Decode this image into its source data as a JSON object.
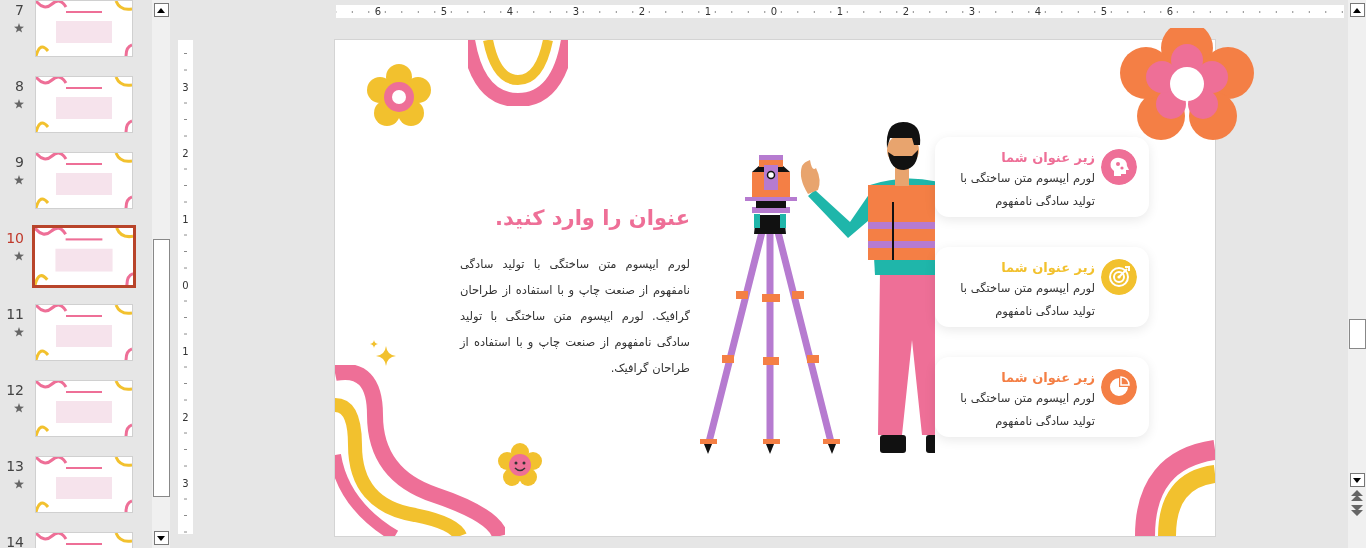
{
  "slide_panel": {
    "slides": [
      {
        "number": "7",
        "selected": false
      },
      {
        "number": "8",
        "selected": false
      },
      {
        "number": "9",
        "selected": false
      },
      {
        "number": "10",
        "selected": true
      },
      {
        "number": "11",
        "selected": false
      },
      {
        "number": "12",
        "selected": false
      },
      {
        "number": "13",
        "selected": false
      },
      {
        "number": "14",
        "selected": false
      }
    ]
  },
  "rulers": {
    "horizontal": [
      "6",
      "5",
      "4",
      "3",
      "2",
      "1",
      "0",
      "1",
      "2",
      "3",
      "4",
      "5",
      "6"
    ],
    "vertical": [
      "3",
      "2",
      "1",
      "0",
      "1",
      "2",
      "3"
    ]
  },
  "slide": {
    "title": "عنوان را وارد کنید.",
    "body": "لورم ایپسوم متن ساختگی با تولید سادگی نامفهوم از صنعت چاپ و با استفاده از طراحان گرافیک. لورم ایپسوم متن ساختگی با تولید سادگی نامفهوم از صنعت چاپ و با استفاده از طراحان گرافیک.",
    "cards": [
      {
        "kind": "head",
        "title": "زیر عنوان شما",
        "text": "لورم ایپسوم متن ساختگی با تولید سادگی نامفهوم",
        "color": "#ee6f97"
      },
      {
        "kind": "target",
        "title": "زیر عنوان شما",
        "text": "لورم ایپسوم متن ساختگی با تولید سادگی نامفهوم",
        "color": "#f2c12e"
      },
      {
        "kind": "pie",
        "title": "زیر عنوان شما",
        "text": "لورم ایپسوم متن ساختگی با تولید سادگی نامفهوم",
        "color": "#f47f45"
      }
    ]
  }
}
